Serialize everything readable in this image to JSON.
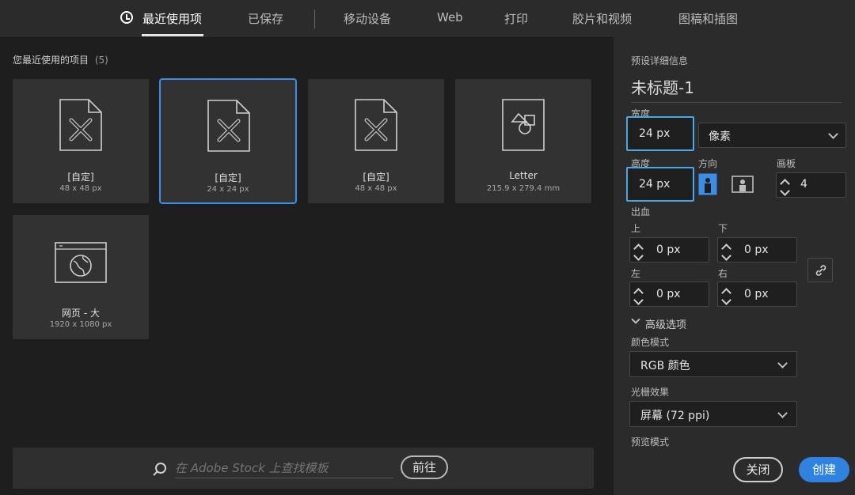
{
  "tabs": [
    {
      "label": "最近使用项",
      "active": true
    },
    {
      "label": "已保存"
    },
    {
      "label": "移动设备"
    },
    {
      "label": "Web"
    },
    {
      "label": "打印"
    },
    {
      "label": "胶片和视频"
    },
    {
      "label": "图稿和插图"
    }
  ],
  "recent": {
    "title": "您最近使用的项目",
    "count": "(5)",
    "items": [
      {
        "name": "[自定]",
        "size": "48 x 48 px",
        "icon": "artboard-file-icon"
      },
      {
        "name": "[自定]",
        "size": "24 x 24 px",
        "icon": "artboard-file-icon"
      },
      {
        "name": "[自定]",
        "size": "48 x 48 px",
        "icon": "artboard-file-icon"
      },
      {
        "name": "Letter",
        "size": "215.9 x 279.4 mm",
        "icon": "print-file-icon"
      },
      {
        "name": "网页 - 大",
        "size": "1920 x 1080 px",
        "icon": "web-globe-icon"
      }
    ]
  },
  "stock": {
    "placeholder": "在 Adobe Stock 上查找模板",
    "go_label": "前往"
  },
  "preset": {
    "section_title": "预设详细信息",
    "name": "未标题-1",
    "width_label": "宽度",
    "width_value": "24 px",
    "unit_value": "像素",
    "height_label": "高度",
    "height_value": "24 px",
    "orientation_label": "方向",
    "artboards_label": "画板",
    "artboards_value": "4",
    "bleed_label": "出血",
    "bleed_top_label": "上",
    "bleed_top": "0 px",
    "bleed_bottom_label": "下",
    "bleed_bottom": "0 px",
    "bleed_left_label": "左",
    "bleed_left": "0 px",
    "bleed_right_label": "右",
    "bleed_right": "0 px",
    "advanced_label": "高级选项",
    "color_mode_label": "颜色模式",
    "color_mode_value": "RGB 颜色",
    "raster_label": "光栅效果",
    "raster_value": "屏幕 (72 ppi)",
    "preview_label": "预览模式",
    "close_label": "关闭",
    "create_label": "创建"
  },
  "colors": {
    "accent": "#2f82e0",
    "highlight": "#4aa8e8"
  }
}
